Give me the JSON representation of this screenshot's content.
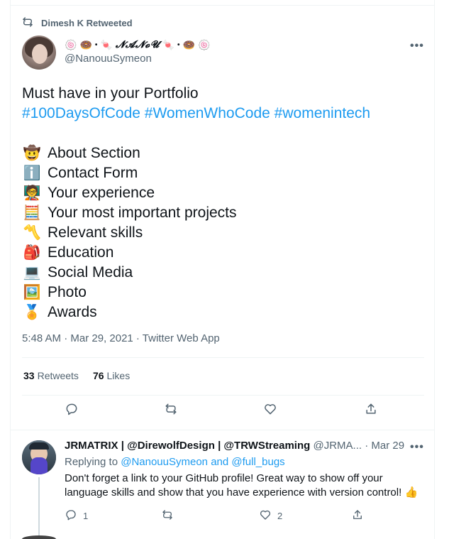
{
  "retweet_banner": {
    "text": "Dimesh K Retweeted"
  },
  "tweet": {
    "display_name_parts": [
      "🍥",
      "🍩",
      "•",
      "🍬",
      "𝓝𝓐𝓝𝓸𝓤",
      "🍬",
      "•",
      "🍩",
      "🍥"
    ],
    "handle": "@NanouuSymeon",
    "more_label": "•••",
    "text_line1": "Must have in your Portfolio",
    "hashtags": [
      "#100DaysOfCode",
      "#WomenWhoCode",
      "#womenintech"
    ],
    "items": [
      {
        "icon": "🤠",
        "label": "About Section"
      },
      {
        "icon": "ℹ️",
        "label": "Contact Form"
      },
      {
        "icon": "🧑‍🏫",
        "label": "Your experience"
      },
      {
        "icon": "🧮",
        "label": "Your most important projects"
      },
      {
        "icon": "〽️",
        "label": "Relevant skills"
      },
      {
        "icon": "🎒",
        "label": "Education"
      },
      {
        "icon": "💻",
        "label": "Social Media"
      },
      {
        "icon": "🖼️",
        "label": "Photo"
      },
      {
        "icon": "🏅",
        "label": "Awards"
      }
    ],
    "timestamp": "5:48 AM · Mar 29, 2021 · Twitter Web App",
    "retweets_count": "33",
    "retweets_label": "Retweets",
    "likes_count": "76",
    "likes_label": "Likes"
  },
  "reply": {
    "name": "JRMATRIX | @DirewolfDesign | @TRWStreaming",
    "handle_date": "@JRMA... · Mar 29",
    "more_label": "•••",
    "replying_prefix": "Replying to",
    "replying_user1": "@NanouuSymeon",
    "replying_and": "and",
    "replying_user2": "@full_bugs",
    "text": "Don't forget a link to your GitHub profile! Great way to show off your language skills and show that you have experience with version control! 👍",
    "reply_count": "1",
    "like_count": "2"
  },
  "colors": {
    "accent": "#1d9bf0",
    "muted": "#536471",
    "text": "#0f1419",
    "border": "#eff3f4"
  }
}
